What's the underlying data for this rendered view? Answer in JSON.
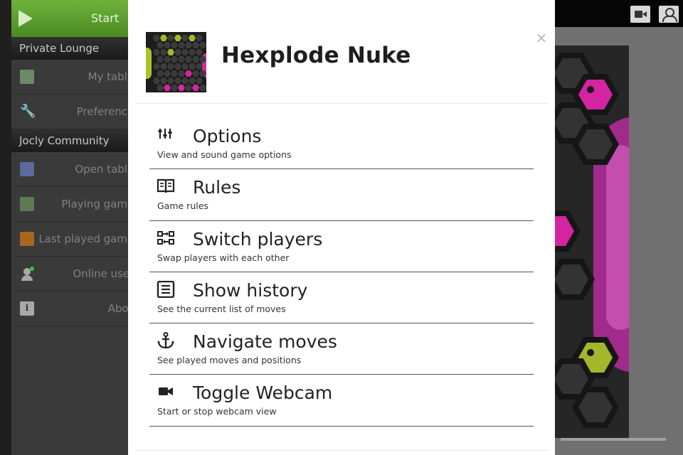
{
  "sidebar": {
    "start_label": "Start",
    "sections": [
      {
        "title": "Private Lounge",
        "items": [
          {
            "label": "My tables",
            "icon": "tables-icon"
          },
          {
            "label": "Preferences",
            "icon": "wrench-icon"
          }
        ]
      },
      {
        "title": "Jocly Community",
        "items": [
          {
            "label": "Open tables",
            "icon": "open-tables-icon"
          },
          {
            "label": "Playing games",
            "icon": "playing-games-icon"
          },
          {
            "label": "Last played games",
            "icon": "last-played-icon"
          },
          {
            "label": "Online users",
            "icon": "online-users-icon"
          },
          {
            "label": "About",
            "icon": "info-icon"
          }
        ]
      }
    ]
  },
  "modal": {
    "title": "Hexplode Nuke",
    "close_glyph": "×",
    "items": [
      {
        "title": "Options",
        "desc": "View and sound game options",
        "icon": "sliders-icon"
      },
      {
        "title": "Rules",
        "desc": "Game rules",
        "icon": "book-icon"
      },
      {
        "title": "Switch players",
        "desc": "Swap players with each other",
        "icon": "switch-icon"
      },
      {
        "title": "Show history",
        "desc": "See the current list of moves",
        "icon": "list-icon"
      },
      {
        "title": "Navigate moves",
        "desc": "See played moves and positions",
        "icon": "anchor-icon"
      },
      {
        "title": "Toggle Webcam",
        "desc": "Start or stop webcam view",
        "icon": "video-camera-icon"
      }
    ]
  },
  "colors": {
    "start_green": "#5a9e2e",
    "magenta": "#d2259f",
    "lime": "#a4b62a"
  }
}
